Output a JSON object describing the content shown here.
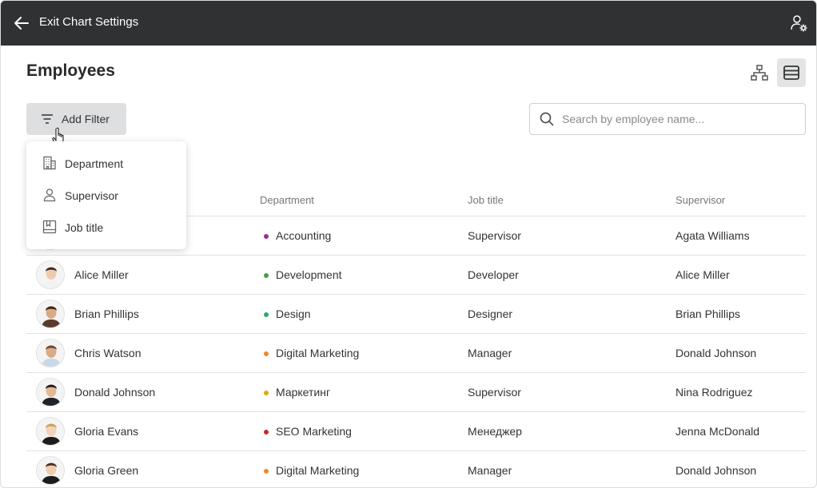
{
  "topbar": {
    "title": "Exit Chart Settings"
  },
  "page": {
    "title": "Employees"
  },
  "filter": {
    "button_label": "Add Filter",
    "menu": [
      {
        "label": "Department",
        "icon": "building-icon"
      },
      {
        "label": "Supervisor",
        "icon": "person-icon"
      },
      {
        "label": "Job title",
        "icon": "badge-icon"
      }
    ]
  },
  "search": {
    "placeholder": "Search by employee name..."
  },
  "table": {
    "columns": [
      "Department",
      "Job title",
      "Supervisor"
    ],
    "rows": [
      {
        "name": "",
        "department": "Accounting",
        "dept_color": "#9c2c8a",
        "job_title": "Supervisor",
        "supervisor": "Agata Williams"
      },
      {
        "name": "Alice Miller",
        "department": "Development",
        "dept_color": "#43a047",
        "job_title": "Developer",
        "supervisor": "Alice Miller"
      },
      {
        "name": "Brian Phillips",
        "department": "Design",
        "dept_color": "#2eaa6a",
        "job_title": "Designer",
        "supervisor": "Brian Phillips"
      },
      {
        "name": "Chris Watson",
        "department": "Digital Marketing",
        "dept_color": "#f08a24",
        "job_title": "Manager",
        "supervisor": "Donald Johnson"
      },
      {
        "name": "Donald Johnson",
        "department": "Маркетинг",
        "dept_color": "#e0a800",
        "job_title": "Supervisor",
        "supervisor": "Nina Rodriguez"
      },
      {
        "name": "Gloria Evans",
        "department": "SEO Marketing",
        "dept_color": "#c62828",
        "job_title": "Менеджер",
        "supervisor": "Jenna McDonald"
      },
      {
        "name": "Gloria Green",
        "department": "Digital Marketing",
        "dept_color": "#f08a24",
        "job_title": "Manager",
        "supervisor": "Donald Johnson"
      }
    ]
  }
}
